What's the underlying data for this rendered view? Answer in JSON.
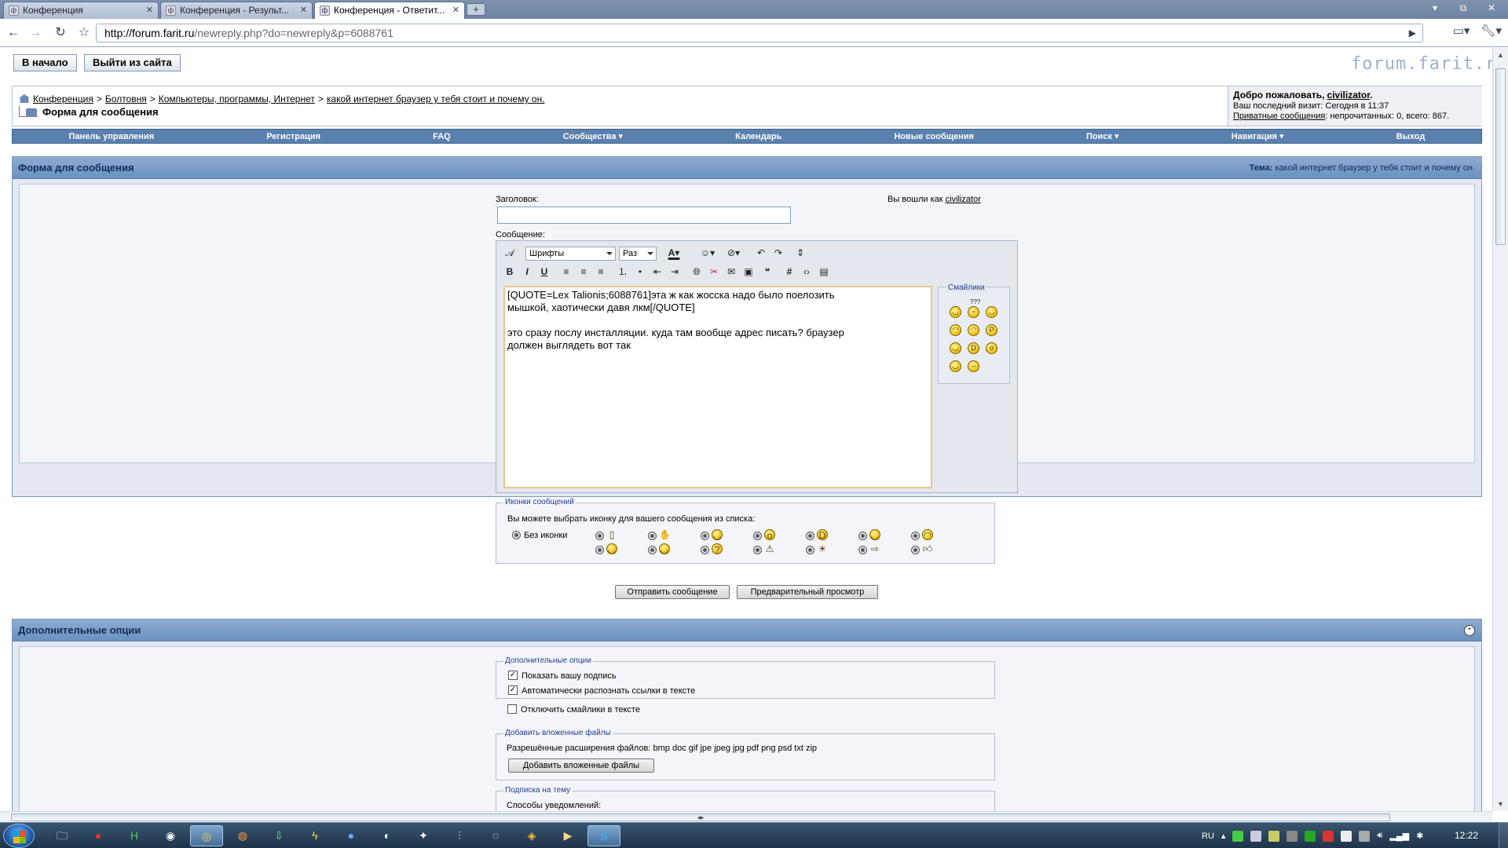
{
  "browser": {
    "tabs": [
      {
        "label": "Конференция"
      },
      {
        "label": "Конференция - Результ..."
      },
      {
        "label": "Конференция - Ответит..."
      }
    ],
    "url_host": "http://forum.farit.ru",
    "url_rest": "/newreply.php?do=newreply&p=6088761"
  },
  "header": {
    "home_button": "В начало",
    "logout_button": "Выйти из сайта",
    "logo": "forum.farit.ru"
  },
  "breadcrumb": {
    "items": [
      "Конференция",
      "Болтовня",
      "Компьютеры, программы, Интернет",
      "какой интернет браузер у тебя стоит и почему он."
    ],
    "separator": ">",
    "current": "Форма для сообщения"
  },
  "welcome": {
    "greeting": "Добро пожаловать,",
    "username": "civilizator",
    "dot": ".",
    "last_visit": "Ваш последний визит: Сегодня в 11:37",
    "pm_link": "Приватные сообщения",
    "pm_status": ": непрочитанных: 0, всего: 867."
  },
  "navbar": [
    "Панель управления",
    "Регистрация",
    "FAQ",
    "Сообщества ▾",
    "Календарь",
    "Новые сообщения",
    "Поиск ▾",
    "Навигация ▾",
    "Выход"
  ],
  "form_panel": {
    "title": "Форма для сообщения",
    "topic_label": "Тема:",
    "topic_value": "какой интернет браузер у тебя стоит и почему он.",
    "title_label": "Заголовок:",
    "logged_in_as": "Вы вошли как",
    "logged_user": "civilizator",
    "message_label": "Сообщение:",
    "font_select": "Шрифты",
    "size_select": "Раз",
    "message_text": "[QUOTE=Lex Talionis;6088761]эта ж как жосска надо было поелозить\nмышкой, хаотически давя лкм[/QUOTE]\n\nэто сразу послу инсталляции. куда там вообще адрес писать? браузер\nдолжен выглядеть вот так",
    "smilies_legend": "Смайлики",
    "smiley_extra": "???",
    "icons_legend": "Иконки сообщений",
    "icons_hint": "Вы можете выбрать иконку для вашего сообщения из списка:",
    "no_icon_label": "Без иконки",
    "submit_button": "Отправить сообщение",
    "preview_button": "Предварительный просмотр"
  },
  "extra_panel": {
    "title": "Дополнительные опции",
    "options_legend": "Дополнительные опции",
    "options": [
      {
        "label": "Показать вашу подпись",
        "checked": true
      },
      {
        "label": "Автоматически распознать ссылки в тексте",
        "checked": true
      },
      {
        "label": "Отключить смайлики в тексте",
        "checked": false
      }
    ],
    "attach_legend": "Добавить вложенные файлы",
    "attach_allowed": "Разрешённые расширения файлов: bmp doc gif jpe jpeg jpg pdf png psd txt zip",
    "attach_button": "Добавить вложенные файлы",
    "subscribe_legend": "Подписка на тему",
    "subscribe_label": "Способы уведомлений:"
  },
  "taskbar": {
    "lang": "RU",
    "clock": "12:22"
  },
  "colors": {
    "nav_blue": "#5a80ae",
    "panel_bg": "#e3e8f3",
    "link_dark": "#0e2d5b"
  }
}
